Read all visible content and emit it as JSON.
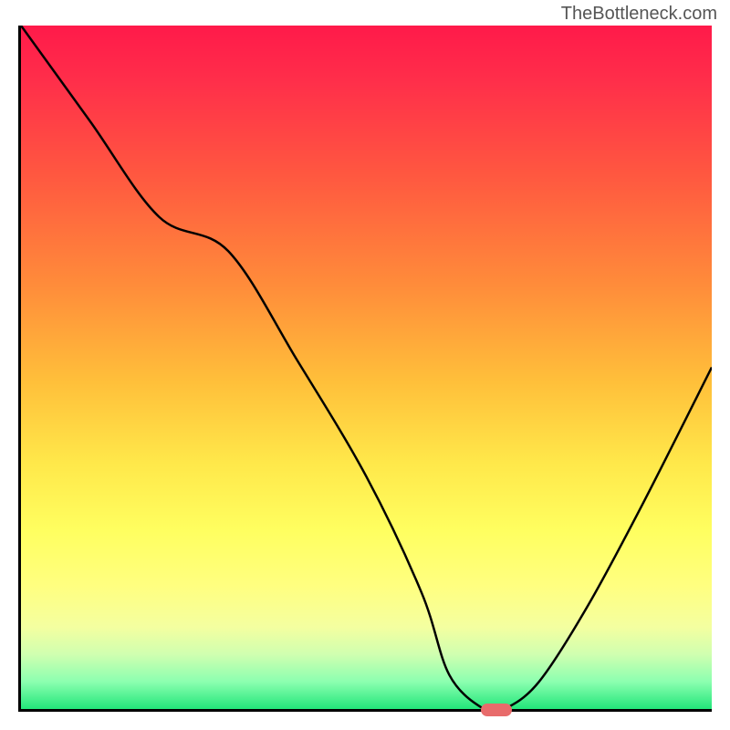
{
  "watermark": "TheBottleneck.com",
  "chart_data": {
    "type": "line",
    "title": "",
    "xlabel": "",
    "ylabel": "",
    "xlim": [
      0,
      100
    ],
    "ylim": [
      0,
      100
    ],
    "x": [
      0,
      10,
      20,
      30,
      40,
      50,
      58,
      62,
      67,
      70,
      75,
      82,
      90,
      100
    ],
    "y": [
      100,
      86,
      72,
      67,
      51,
      34,
      17,
      5,
      0,
      0,
      4,
      15,
      30,
      50
    ],
    "marker": {
      "x": 68.5,
      "y": 0
    },
    "background_gradient": {
      "top": "#ff1a4a",
      "mid": "#ffe84a",
      "bottom": "#22e67a"
    }
  }
}
